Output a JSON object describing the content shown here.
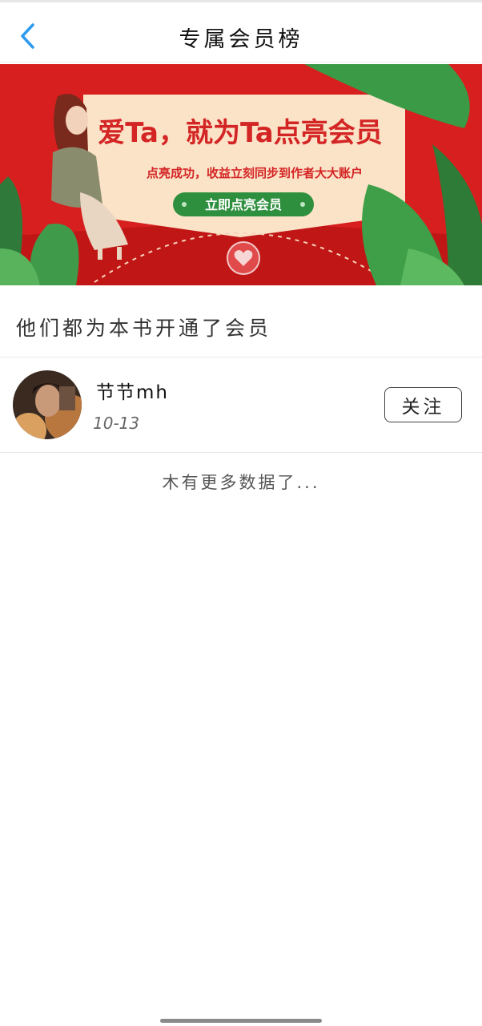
{
  "header": {
    "title": "专属会员榜",
    "back_icon": "chevron-left-icon",
    "accent_color": "#2d9bf0"
  },
  "banner": {
    "headline": "爱Ta，就为Ta点亮会员",
    "subline": "点亮成功，收益立刻同步到作者大大账户",
    "button_label": "立即点亮会员",
    "bg_color": "#d71f1f",
    "card_color": "#fbe3c8",
    "button_color": "#2e8f3e",
    "seal_icon": "heart-seal-icon"
  },
  "section": {
    "title": "他们都为本书开通了会员"
  },
  "members": [
    {
      "name": "节节mh",
      "date": "10-13",
      "follow_label": "关注"
    }
  ],
  "footer": {
    "no_more_text": "木有更多数据了..."
  }
}
